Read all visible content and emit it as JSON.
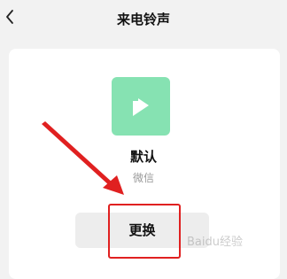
{
  "header": {
    "title": "来电铃声",
    "back_icon": "chevron-left-icon"
  },
  "ringtone": {
    "icon": "play-icon",
    "icon_color": "#86e2b2",
    "name": "默认",
    "source": "微信"
  },
  "actions": {
    "change_label": "更换"
  },
  "annotation": {
    "color": "#e02020"
  },
  "watermark": {
    "text": "Baidu经验"
  }
}
